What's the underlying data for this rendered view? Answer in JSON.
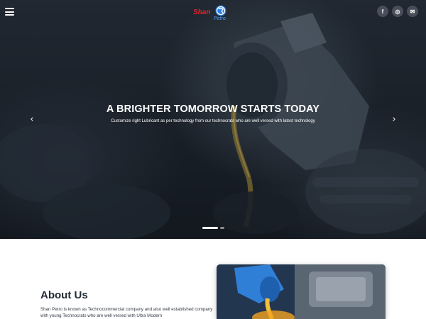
{
  "brand": {
    "name_part1": "Shan",
    "name_part2": "Petro",
    "primary_color": "#e0262e",
    "accent_color": "#4ea3ff"
  },
  "header": {
    "menu_icon": "hamburger-icon",
    "social": [
      {
        "name": "facebook",
        "icon": "facebook-icon",
        "glyph": "f"
      },
      {
        "name": "instagram",
        "icon": "instagram-icon",
        "glyph": "◎"
      },
      {
        "name": "email",
        "icon": "mail-icon",
        "glyph": "✉"
      }
    ]
  },
  "hero": {
    "title": "A BRIGHTER TOMORROW STARTS TODAY",
    "subtitle": "Customize right Lubricant as per technology from our technocrats who are well versed with latest technology",
    "prev_icon": "chevron-left-icon",
    "next_icon": "chevron-right-icon",
    "prev_glyph": "‹",
    "next_glyph": "›",
    "slides_total": 2,
    "slide_active": 1
  },
  "about": {
    "heading": "About Us",
    "text": "Shan Petro is known as Technocommercial company and also well established company with young Technocrats who are well versed with Ultra Modern"
  }
}
